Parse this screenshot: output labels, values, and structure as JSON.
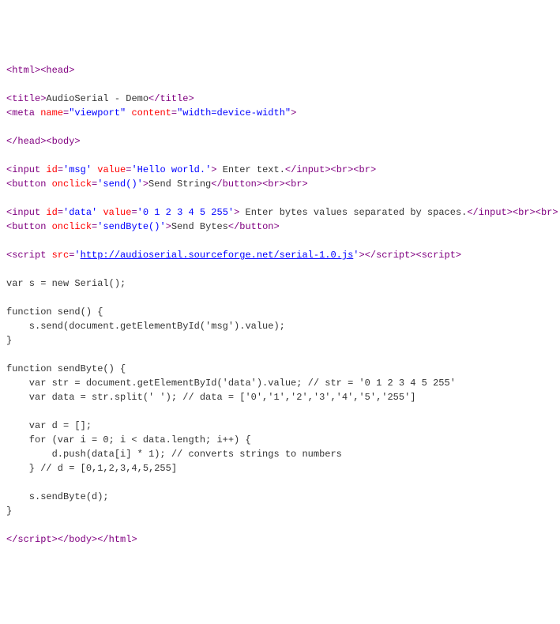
{
  "lines": [
    {
      "segments": [
        {
          "cls": "tag",
          "text": "<html>"
        },
        {
          "cls": "tag",
          "text": "<head>"
        }
      ]
    },
    {
      "segments": []
    },
    {
      "segments": [
        {
          "cls": "tag",
          "text": "<title>"
        },
        {
          "cls": "text",
          "text": "AudioSerial - Demo"
        },
        {
          "cls": "tag",
          "text": "</title>"
        }
      ]
    },
    {
      "segments": [
        {
          "cls": "tag",
          "text": "<meta "
        },
        {
          "cls": "attr-name",
          "text": "name"
        },
        {
          "cls": "tag",
          "text": "="
        },
        {
          "cls": "attr-value",
          "text": "\"viewport\""
        },
        {
          "cls": "tag",
          "text": " "
        },
        {
          "cls": "attr-name",
          "text": "content"
        },
        {
          "cls": "tag",
          "text": "="
        },
        {
          "cls": "attr-value",
          "text": "\"width=device-width\""
        },
        {
          "cls": "tag",
          "text": ">"
        }
      ]
    },
    {
      "segments": []
    },
    {
      "segments": [
        {
          "cls": "tag",
          "text": "</head>"
        },
        {
          "cls": "tag",
          "text": "<body>"
        }
      ]
    },
    {
      "segments": []
    },
    {
      "segments": [
        {
          "cls": "tag",
          "text": "<input "
        },
        {
          "cls": "attr-name",
          "text": "id"
        },
        {
          "cls": "tag",
          "text": "="
        },
        {
          "cls": "attr-value",
          "text": "'msg'"
        },
        {
          "cls": "tag",
          "text": " "
        },
        {
          "cls": "attr-name",
          "text": "value"
        },
        {
          "cls": "tag",
          "text": "="
        },
        {
          "cls": "attr-value",
          "text": "'Hello world.'"
        },
        {
          "cls": "tag",
          "text": ">"
        },
        {
          "cls": "text",
          "text": " Enter text."
        },
        {
          "cls": "tag",
          "text": "</input>"
        },
        {
          "cls": "tag",
          "text": "<br>"
        },
        {
          "cls": "tag",
          "text": "<br>"
        }
      ]
    },
    {
      "segments": [
        {
          "cls": "tag",
          "text": "<button "
        },
        {
          "cls": "attr-name",
          "text": "onclick"
        },
        {
          "cls": "tag",
          "text": "="
        },
        {
          "cls": "attr-value",
          "text": "'send()'"
        },
        {
          "cls": "tag",
          "text": ">"
        },
        {
          "cls": "text",
          "text": "Send String"
        },
        {
          "cls": "tag",
          "text": "</button>"
        },
        {
          "cls": "tag",
          "text": "<br>"
        },
        {
          "cls": "tag",
          "text": "<br>"
        }
      ]
    },
    {
      "segments": []
    },
    {
      "segments": [
        {
          "cls": "tag",
          "text": "<input "
        },
        {
          "cls": "attr-name",
          "text": "id"
        },
        {
          "cls": "tag",
          "text": "="
        },
        {
          "cls": "attr-value",
          "text": "'data'"
        },
        {
          "cls": "tag",
          "text": " "
        },
        {
          "cls": "attr-name",
          "text": "value"
        },
        {
          "cls": "tag",
          "text": "="
        },
        {
          "cls": "attr-value",
          "text": "'0 1 2 3 4 5 255'"
        },
        {
          "cls": "tag",
          "text": ">"
        },
        {
          "cls": "text",
          "text": " Enter bytes values separated by spaces."
        },
        {
          "cls": "tag",
          "text": "</input>"
        },
        {
          "cls": "tag",
          "text": "<br>"
        },
        {
          "cls": "tag",
          "text": "<br>"
        }
      ]
    },
    {
      "segments": [
        {
          "cls": "tag",
          "text": "<button "
        },
        {
          "cls": "attr-name",
          "text": "onclick"
        },
        {
          "cls": "tag",
          "text": "="
        },
        {
          "cls": "attr-value",
          "text": "'sendByte()'"
        },
        {
          "cls": "tag",
          "text": ">"
        },
        {
          "cls": "text",
          "text": "Send Bytes"
        },
        {
          "cls": "tag",
          "text": "</button>"
        }
      ]
    },
    {
      "segments": []
    },
    {
      "segments": [
        {
          "cls": "tag",
          "text": "<script "
        },
        {
          "cls": "attr-name",
          "text": "src"
        },
        {
          "cls": "tag",
          "text": "="
        },
        {
          "cls": "attr-value",
          "text": "'"
        },
        {
          "cls": "script-url",
          "text": "http://audioserial.sourceforge.net/serial-1.0.js"
        },
        {
          "cls": "attr-value",
          "text": "'"
        },
        {
          "cls": "tag",
          "text": ">"
        },
        {
          "cls": "tag",
          "text": "</script>"
        },
        {
          "cls": "tag",
          "text": "<script>"
        }
      ]
    },
    {
      "segments": []
    },
    {
      "segments": [
        {
          "cls": "text",
          "text": "var s = new Serial();"
        }
      ]
    },
    {
      "segments": []
    },
    {
      "segments": [
        {
          "cls": "text",
          "text": "function send() {"
        }
      ]
    },
    {
      "segments": [
        {
          "cls": "text",
          "text": "    s.send(document.getElementById('msg').value);"
        }
      ]
    },
    {
      "segments": [
        {
          "cls": "text",
          "text": "}"
        }
      ]
    },
    {
      "segments": []
    },
    {
      "segments": [
        {
          "cls": "text",
          "text": "function sendByte() {"
        }
      ]
    },
    {
      "segments": [
        {
          "cls": "text",
          "text": "    var str = document.getElementById('data').value; // str = '0 1 2 3 4 5 255'"
        }
      ]
    },
    {
      "segments": [
        {
          "cls": "text",
          "text": "    var data = str.split(' '); // data = ['0','1','2','3','4','5','255']"
        }
      ]
    },
    {
      "segments": []
    },
    {
      "segments": [
        {
          "cls": "text",
          "text": "    var d = [];"
        }
      ]
    },
    {
      "segments": [
        {
          "cls": "text",
          "text": "    for (var i = 0; i < data.length; i++) {"
        }
      ]
    },
    {
      "segments": [
        {
          "cls": "text",
          "text": "        d.push(data[i] * 1); // converts strings to numbers"
        }
      ]
    },
    {
      "segments": [
        {
          "cls": "text",
          "text": "    } // d = [0,1,2,3,4,5,255]"
        }
      ]
    },
    {
      "segments": []
    },
    {
      "segments": [
        {
          "cls": "text",
          "text": "    s.sendByte(d);"
        }
      ]
    },
    {
      "segments": [
        {
          "cls": "text",
          "text": "}"
        }
      ]
    },
    {
      "segments": []
    },
    {
      "segments": [
        {
          "cls": "tag",
          "text": "</script>"
        },
        {
          "cls": "tag",
          "text": "</body>"
        },
        {
          "cls": "tag",
          "text": "</html>"
        }
      ]
    }
  ]
}
